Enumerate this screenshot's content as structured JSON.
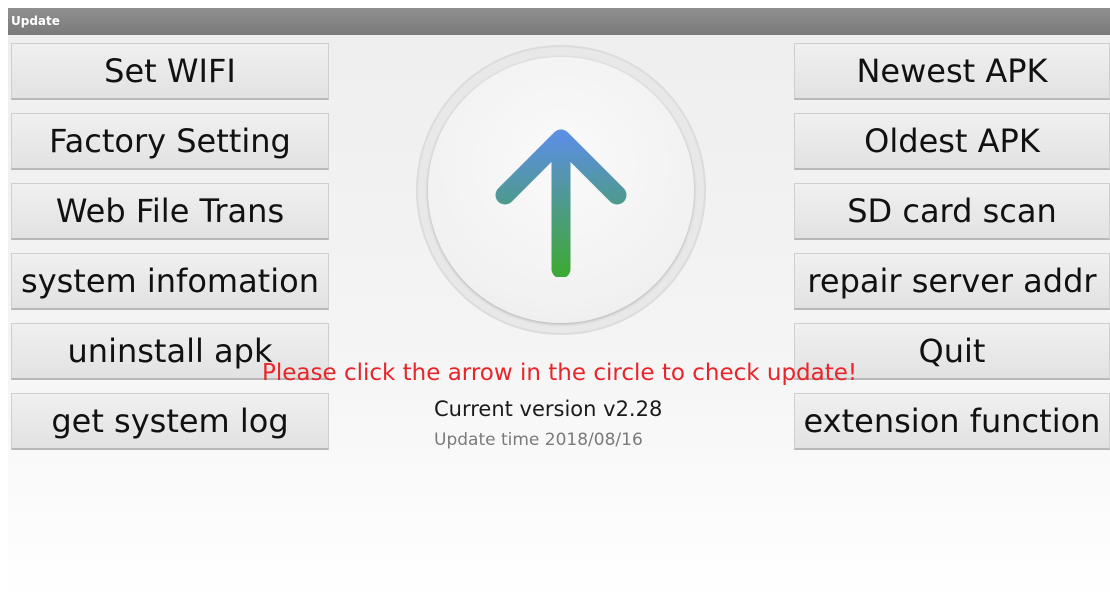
{
  "window": {
    "title": "Update"
  },
  "left_buttons": [
    {
      "label": "Set WIFI"
    },
    {
      "label": "Factory Setting"
    },
    {
      "label": "Web File Trans"
    },
    {
      "label": "system infomation"
    },
    {
      "label": "uninstall apk"
    },
    {
      "label": "get system log"
    }
  ],
  "right_buttons": [
    {
      "label": "Newest APK"
    },
    {
      "label": "Oldest APK"
    },
    {
      "label": "SD card scan"
    },
    {
      "label": "repair server addr"
    },
    {
      "label": "Quit"
    },
    {
      "label": "extension function"
    }
  ],
  "update_circle": {
    "icon": "arrow-up-icon",
    "arrow_colors": [
      "#5b8fdf",
      "#3fa83a"
    ]
  },
  "hint_text": "Please click the arrow in the circle to check update!",
  "version_text": "Current version  v2.28",
  "update_time_text": "Update time  2018/08/16",
  "colors": {
    "hint": "#e8252a",
    "titlebar": "#858585"
  }
}
